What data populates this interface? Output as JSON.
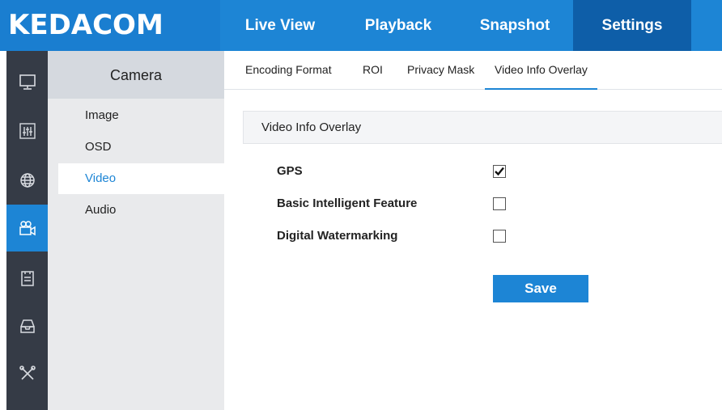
{
  "app": {
    "logo": "KEDACOM",
    "brand_color": "#1d85d5",
    "active_color": "#0e5ea8",
    "sidebar_color": "#353b46"
  },
  "topnav": {
    "items": [
      {
        "label": "Live View",
        "active": false
      },
      {
        "label": "Playback",
        "active": false
      },
      {
        "label": "Snapshot",
        "active": false
      },
      {
        "label": "Settings",
        "active": true
      }
    ]
  },
  "iconbar": {
    "items": [
      {
        "icon": "monitor-icon",
        "active": false
      },
      {
        "icon": "sliders-icon",
        "active": false
      },
      {
        "icon": "network-globe-icon",
        "active": false
      },
      {
        "icon": "camera-icon",
        "active": true
      },
      {
        "icon": "event-clipboard-icon",
        "active": false
      },
      {
        "icon": "storage-tray-icon",
        "active": false
      },
      {
        "icon": "tools-icon",
        "active": false
      }
    ]
  },
  "leftpanel": {
    "title": "Camera",
    "items": [
      {
        "label": "Image",
        "active": false
      },
      {
        "label": "OSD",
        "active": false
      },
      {
        "label": "Video",
        "active": true
      },
      {
        "label": "Audio",
        "active": false
      }
    ]
  },
  "subtabs": {
    "items": [
      {
        "label": "Encoding Format",
        "active": false
      },
      {
        "label": "ROI",
        "active": false
      },
      {
        "label": "Privacy Mask",
        "active": false
      },
      {
        "label": "Video Info Overlay",
        "active": true
      }
    ]
  },
  "content": {
    "section_title": "Video Info Overlay",
    "options": [
      {
        "label": "GPS",
        "checked": true
      },
      {
        "label": "Basic Intelligent Feature",
        "checked": false
      },
      {
        "label": "Digital Watermarking",
        "checked": false
      }
    ],
    "save_label": "Save"
  }
}
